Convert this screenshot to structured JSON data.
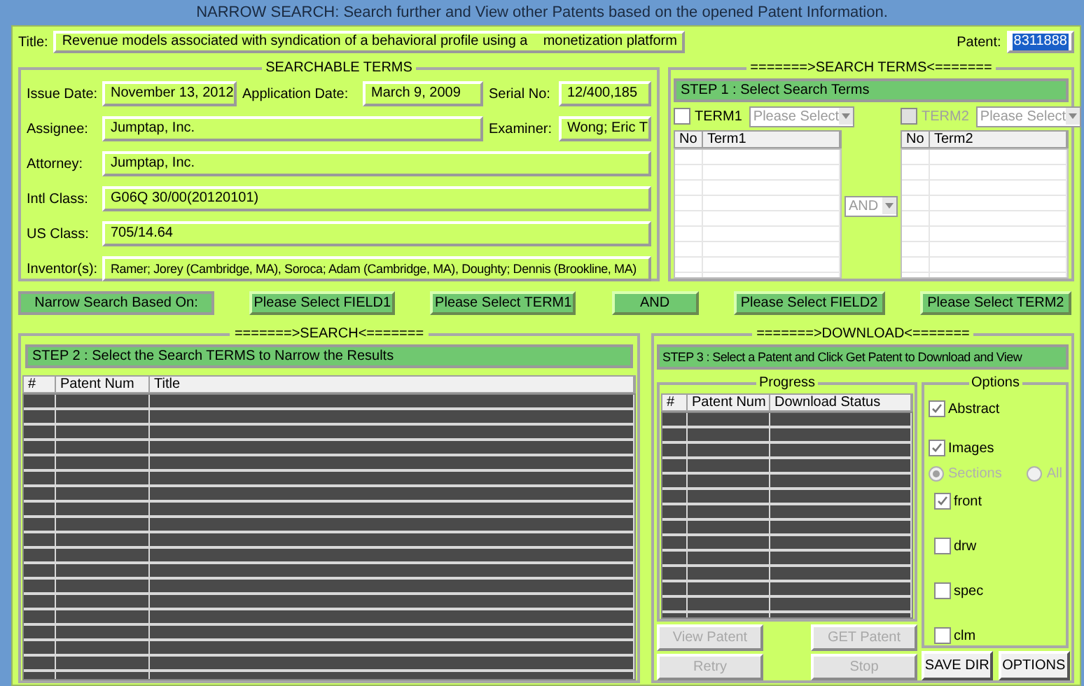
{
  "window": {
    "title": "NARROW SEARCH: Search further and View other Patents based on the opened Patent Information."
  },
  "title_field": {
    "label": "Title:",
    "value": "Revenue models associated with syndication of a behavioral profile using a    monetization platform"
  },
  "patent_field": {
    "label": "Patent:",
    "value": "8311888",
    "selected": true
  },
  "searchable_terms": {
    "legend": "SEARCHABLE TERMS",
    "fields": [
      {
        "label": "Issue Date:",
        "value": "November 13, 2012"
      },
      {
        "label": "Application Date:",
        "value": "March 9, 2009"
      },
      {
        "label": "Serial No:",
        "value": "12/400,185"
      },
      {
        "label": "Assignee:",
        "value": "Jumptap, Inc."
      },
      {
        "label": "Examiner:",
        "value": "Wong; Eric T"
      },
      {
        "label": "Attorney:",
        "value": "Jumptap, Inc."
      },
      {
        "label": "Intl Class:",
        "value": "G06Q 30/00(20120101)"
      },
      {
        "label": "US Class:",
        "value": "705/14.64"
      },
      {
        "label": "Inventor(s):",
        "value": "Ramer; Jorey (Cambridge, MA), Soroca; Adam (Cambridge, MA), Doughty; Dennis (Brookline, MA)"
      }
    ]
  },
  "search_terms": {
    "legend": "=======>SEARCH TERMS<=======",
    "step": "STEP 1 : Select Search Terms",
    "operator": "AND",
    "terms": [
      {
        "label": "TERM1",
        "checked": false,
        "disabled": false,
        "value": "Please Select",
        "columns": [
          "No",
          "Term1"
        ]
      },
      {
        "label": "TERM2",
        "checked": false,
        "disabled": true,
        "value": "Please Select",
        "columns": [
          "No",
          "Term2"
        ]
      }
    ]
  },
  "narrow_bar": {
    "label": "Narrow Search Based On:",
    "buttons": [
      "Please Select FIELD1",
      "Please Select TERM1",
      "AND",
      "Please Select FIELD2",
      "Please Select TERM2"
    ]
  },
  "search": {
    "legend": "=======>SEARCH<=======",
    "step": "STEP 2 : Select the Search TERMS to Narrow the Results",
    "columns": [
      "#",
      "Patent Num",
      "Title"
    ]
  },
  "download": {
    "legend": "=======>DOWNLOAD<=======",
    "step": "STEP 3 : Select a Patent and Click Get Patent to Download and View",
    "progress": {
      "legend": "Progress",
      "columns": [
        "#",
        "Patent Num",
        "Download Status"
      ]
    },
    "buttons": [
      {
        "label": "View Patent",
        "disabled": true
      },
      {
        "label": "GET Patent",
        "disabled": true
      },
      {
        "label": "Retry",
        "disabled": true
      },
      {
        "label": "Stop",
        "disabled": true
      }
    ],
    "options": {
      "legend": "Options",
      "items": [
        {
          "kind": "checkbox",
          "label": "Abstract",
          "checked": true
        },
        {
          "kind": "checkbox",
          "label": "Images",
          "checked": true
        },
        {
          "kind": "radios",
          "disabled": true,
          "options": [
            {
              "label": "Sections",
              "selected": true
            },
            {
              "label": "All",
              "selected": false
            }
          ]
        },
        {
          "kind": "checkbox",
          "label": "front",
          "checked": true
        },
        {
          "kind": "checkbox",
          "label": "drw",
          "checked": false
        },
        {
          "kind": "checkbox",
          "label": "spec",
          "checked": false
        },
        {
          "kind": "checkbox",
          "label": "clm",
          "checked": false
        }
      ]
    },
    "option_buttons": [
      "SAVE DIR",
      "OPTIONS"
    ]
  }
}
